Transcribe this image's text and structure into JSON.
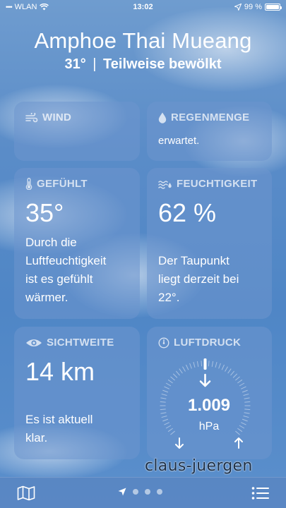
{
  "status": {
    "carrier": "WLAN",
    "time": "13:02",
    "battery": "99 %"
  },
  "location": {
    "city": "Amphoe Thai Mueang",
    "temp": "31°",
    "separator": "|",
    "condition": "Teilweise bewölkt"
  },
  "cards": {
    "wind": {
      "title": "WIND"
    },
    "rain": {
      "title": "REGENMENGE",
      "desc": "erwartet."
    },
    "feels": {
      "title": "GEFÜHLT",
      "value": "35°",
      "desc_lines": [
        "Durch die",
        "Luftfeuchtigkeit",
        "ist es gefühlt",
        "wärmer."
      ]
    },
    "humidity": {
      "title": "FEUCHTIGKEIT",
      "value": "62 %",
      "desc_lines": [
        "Der Taupunkt",
        "liegt derzeit bei",
        "22°."
      ]
    },
    "visibility": {
      "title": "SICHTWEITE",
      "value": "14 km",
      "desc_lines": [
        "Es ist aktuell",
        "klar."
      ]
    },
    "pressure": {
      "title": "LUFTDRUCK",
      "value": "1.009",
      "unit": "hPa"
    }
  },
  "tabbar": {
    "page_count": 3,
    "current_page": 0
  },
  "watermark": "claus-juergen",
  "colors": {
    "background": "#5a8cc8",
    "card": "#6e96cd",
    "title_text": "#d5e2f3",
    "text": "#ffffff"
  },
  "icons": [
    "wifi-icon",
    "location-arrow-icon",
    "battery-icon",
    "wind-icon",
    "raindrop-icon",
    "thermometer-icon",
    "humidity-icon",
    "eye-icon",
    "gauge-icon",
    "map-icon",
    "location-dot-icon",
    "list-icon"
  ]
}
